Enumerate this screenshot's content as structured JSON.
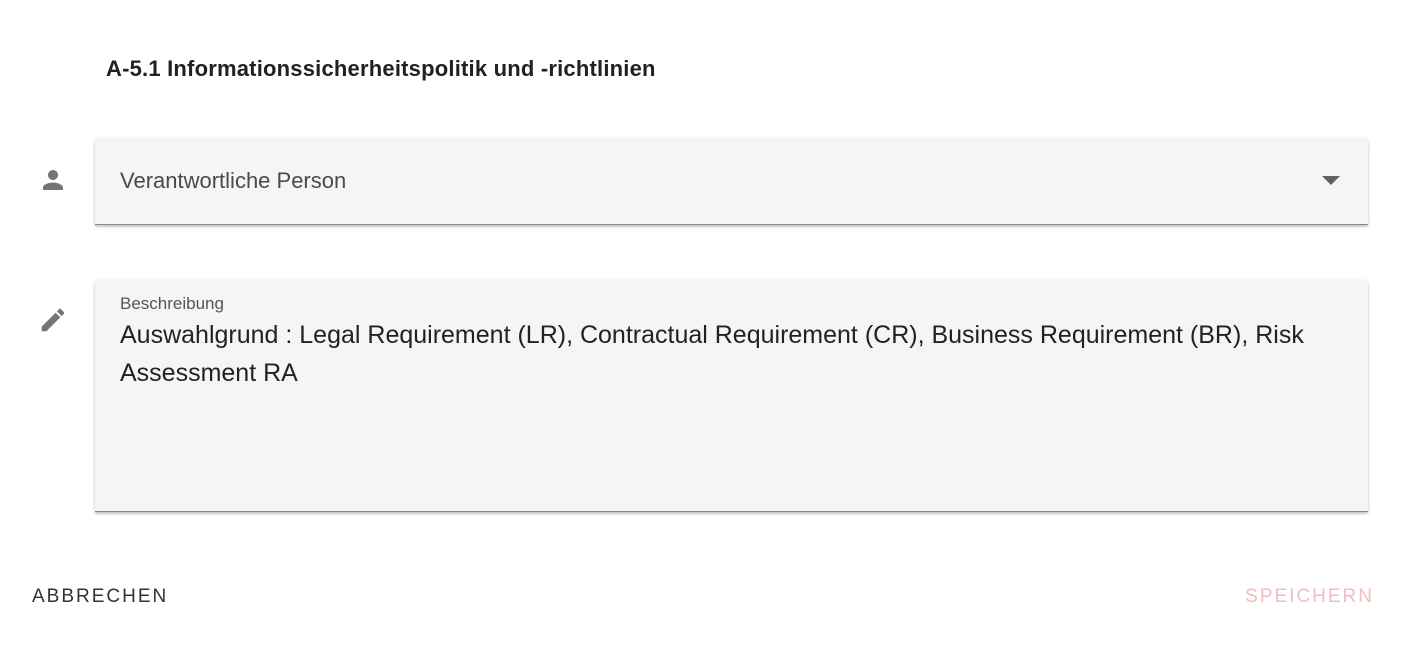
{
  "dialog": {
    "title": "A-5.1 Informationssicherheitspolitik und -richtlinien"
  },
  "responsible": {
    "icon": "person-icon",
    "placeholder": "Verantwortliche Person"
  },
  "description": {
    "icon": "edit-icon",
    "label": "Beschreibung",
    "value": "Auswahlgrund : Legal Requirement (LR), Contractual Requirement (CR), Business Requirement (BR), Risk Assessment RA"
  },
  "actions": {
    "cancel_label": "ABBRECHEN",
    "save_label": "SPEICHERN",
    "save_color_disabled": "#f1bcc0"
  }
}
